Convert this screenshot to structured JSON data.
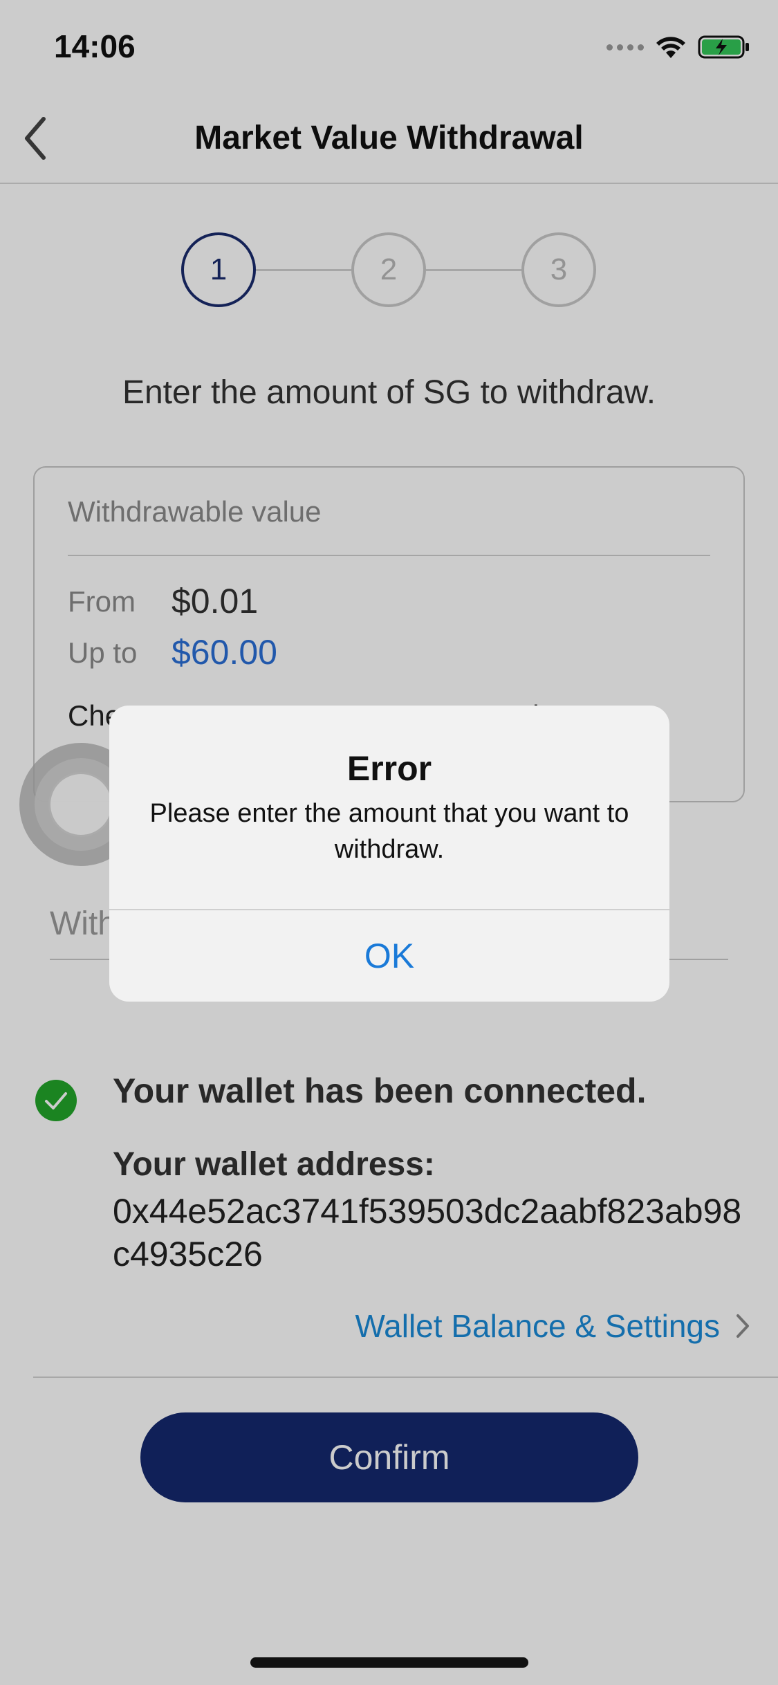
{
  "status_bar": {
    "time": "14:06",
    "icons": [
      "cellular-dots-icon",
      "wifi-icon",
      "battery-charging-icon"
    ]
  },
  "nav": {
    "title": "Market Value Withdrawal",
    "back_icon": "chevron-left-icon"
  },
  "stepper": {
    "steps": [
      "1",
      "2",
      "3"
    ],
    "active_step": 1
  },
  "instruction": "Enter the amount of SG to withdraw.",
  "card": {
    "header": "Withdrawable value",
    "from_label": "From",
    "from_value": "$0.01",
    "upto_label": "Up to",
    "upto_value": "$60.00",
    "note_visible": "Che                                                  the \"Up"
  },
  "amount_input": {
    "placeholder": "With",
    "value": ""
  },
  "wallet": {
    "connected_text": "Your wallet has been connected.",
    "address_label": "Your wallet address:",
    "address": "0x44e52ac3741f539503dc2aabf823ab98c4935c26",
    "link_label": "Wallet Balance & Settings"
  },
  "confirm_label": "Confirm",
  "alert": {
    "title": "Error",
    "message": "Please enter the amount that you want to withdraw.",
    "ok_label": "OK"
  },
  "colors": {
    "primary": "#14286e",
    "link": "#1a8ad8",
    "value_blue": "#2a6fd6",
    "success": "#22a62a"
  }
}
